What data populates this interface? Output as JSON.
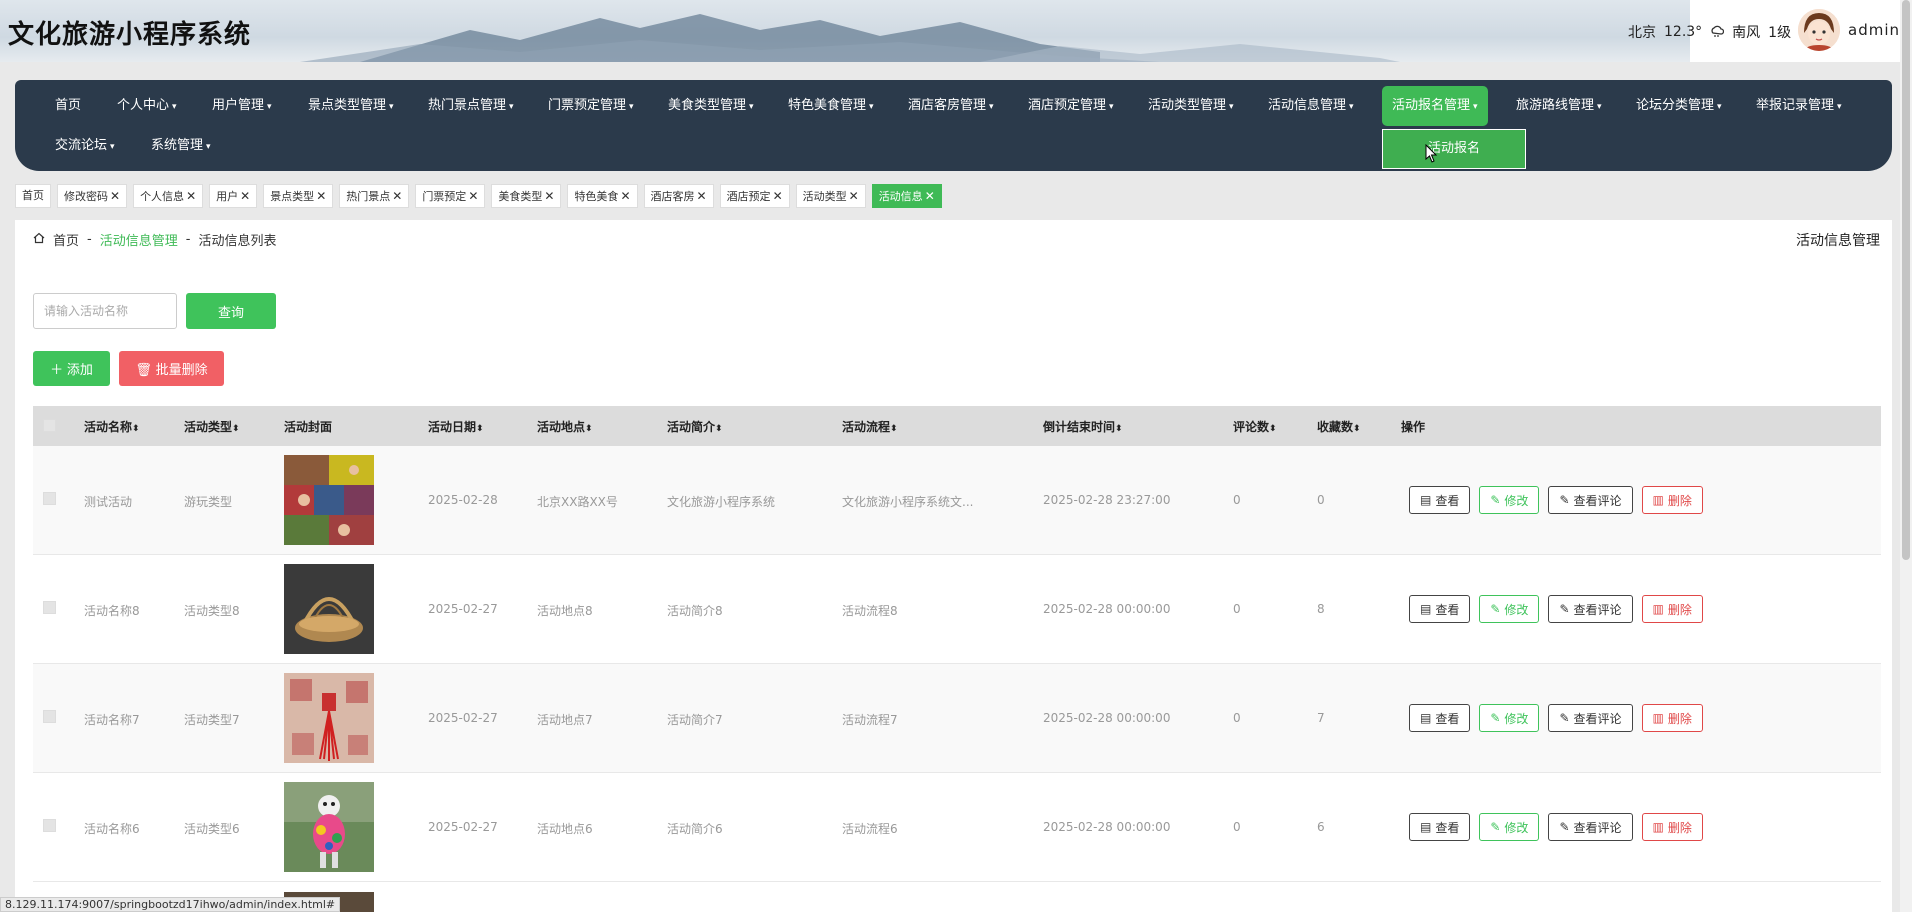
{
  "app": {
    "title": "文化旅游小程序系统"
  },
  "header": {
    "weather": {
      "city": "北京",
      "temp": "12.3°",
      "icon": "weather-icon",
      "wind": "南风",
      "level": "1级"
    },
    "user": {
      "name": "admin"
    }
  },
  "nav": {
    "items": [
      "首页",
      "个人中心",
      "用户管理",
      "景点类型管理",
      "热门景点管理",
      "门票预定管理",
      "美食类型管理",
      "特色美食管理",
      "酒店客房管理",
      "酒店预定管理",
      "活动类型管理",
      "活动信息管理",
      "活动报名管理",
      "旅游路线管理",
      "论坛分类管理",
      "举报记录管理",
      "交流论坛",
      "系统管理"
    ],
    "active": "活动报名管理",
    "dropdown_item": "活动报名"
  },
  "tags": [
    "首页",
    "修改密码",
    "个人信息",
    "用户",
    "景点类型",
    "热门景点",
    "门票预定",
    "美食类型",
    "特色美食",
    "酒店客房",
    "酒店预定",
    "活动类型",
    "活动信息"
  ],
  "breadcrumb": {
    "home": "首页",
    "section": "活动信息管理",
    "page": "活动信息列表",
    "right_title": "活动信息管理"
  },
  "search": {
    "placeholder": "请输入活动名称",
    "query_label": "查询"
  },
  "toolbar": {
    "add_label": "添加",
    "batch_delete_label": "批量删除"
  },
  "table": {
    "headers": [
      "活动名称",
      "活动类型",
      "活动封面",
      "活动日期",
      "活动地点",
      "活动简介",
      "活动流程",
      "倒计结束时间",
      "评论数",
      "收藏数",
      "操作"
    ],
    "action_labels": {
      "view": "查看",
      "edit": "修改",
      "comments": "查看评论",
      "delete": "删除"
    },
    "rows": [
      {
        "name": "测试活动",
        "type": "游玩类型",
        "date": "2025-02-28",
        "place": "北京XX路XX号",
        "intro": "文化旅游小程序系统",
        "flow": "文化旅游小程序系统文...",
        "end": "2025-02-28 23:27:00",
        "comments": "0",
        "favs": "0"
      },
      {
        "name": "活动名称8",
        "type": "活动类型8",
        "date": "2025-02-27",
        "place": "活动地点8",
        "intro": "活动简介8",
        "flow": "活动流程8",
        "end": "2025-02-28 00:00:00",
        "comments": "0",
        "favs": "8"
      },
      {
        "name": "活动名称7",
        "type": "活动类型7",
        "date": "2025-02-27",
        "place": "活动地点7",
        "intro": "活动简介7",
        "flow": "活动流程7",
        "end": "2025-02-28 00:00:00",
        "comments": "0",
        "favs": "7"
      },
      {
        "name": "活动名称6",
        "type": "活动类型6",
        "date": "2025-02-27",
        "place": "活动地点6",
        "intro": "活动简介6",
        "flow": "活动流程6",
        "end": "2025-02-28 00:00:00",
        "comments": "0",
        "favs": "6"
      }
    ]
  },
  "statusbar": {
    "url": "8.129.11.174:9007/springbootzd17ihwo/admin/index.html#"
  },
  "colors": {
    "primary": "#3fc35b",
    "danger": "#f16065",
    "nav_bg": "#2b3a4b"
  }
}
